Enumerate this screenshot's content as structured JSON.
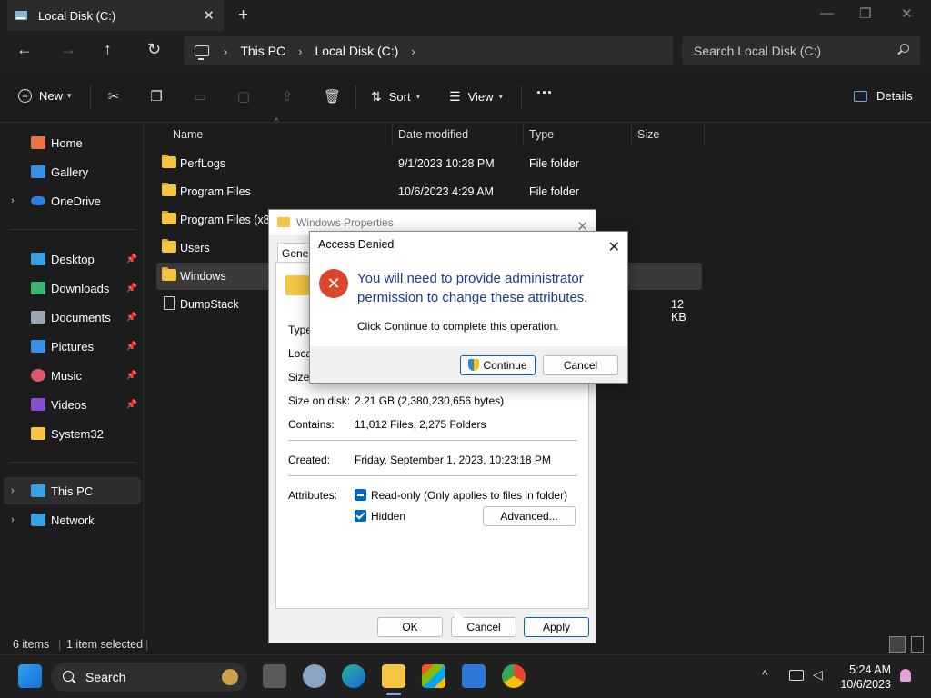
{
  "window": {
    "tab_title": "Local Disk (C:)",
    "new_tab": "+",
    "minimize": "—",
    "maximize": "❐",
    "close": "✕"
  },
  "address": {
    "crumbs": [
      "This PC",
      "Local Disk (C:)"
    ],
    "search_placeholder": "Search Local Disk (C:)"
  },
  "toolbar": {
    "new_label": "New",
    "sort_label": "Sort",
    "view_label": "View",
    "more_label": "···",
    "details_label": "Details"
  },
  "sidebar": {
    "items": [
      {
        "label": "Home",
        "icon": "home-icon",
        "color": "#e8734a"
      },
      {
        "label": "Gallery",
        "icon": "gallery-icon",
        "color": "#3a8ee6"
      },
      {
        "label": "OneDrive",
        "icon": "onedrive-icon",
        "color": "#2d7fd8"
      },
      {
        "label": "Desktop",
        "icon": "desktop-icon",
        "color": "#3aa0e6"
      },
      {
        "label": "Downloads",
        "icon": "downloads-icon",
        "color": "#3cb371"
      },
      {
        "label": "Documents",
        "icon": "documents-icon",
        "color": "#9aa6b8"
      },
      {
        "label": "Pictures",
        "icon": "pictures-icon",
        "color": "#3a8ee6"
      },
      {
        "label": "Music",
        "icon": "music-icon",
        "color": "#e0566b"
      },
      {
        "label": "Videos",
        "icon": "videos-icon",
        "color": "#8a4fd1"
      },
      {
        "label": "System32",
        "icon": "folder-icon",
        "color": "#f4c542"
      },
      {
        "label": "This PC",
        "icon": "this-pc-icon",
        "color": "#3aa0e6"
      },
      {
        "label": "Network",
        "icon": "network-icon",
        "color": "#3aa0e6"
      }
    ]
  },
  "columns": {
    "name": "Name",
    "date": "Date modified",
    "type": "Type",
    "size": "Size"
  },
  "files": [
    {
      "name": "PerfLogs",
      "date": "9/1/2023 10:28 PM",
      "type": "File folder",
      "size": ""
    },
    {
      "name": "Program Files",
      "date": "10/6/2023 4:29 AM",
      "type": "File folder",
      "size": ""
    },
    {
      "name": "Program Files (x86",
      "date": "",
      "type": "",
      "size": ""
    },
    {
      "name": "Users",
      "date": "",
      "type": "",
      "size": ""
    },
    {
      "name": "Windows",
      "date": "",
      "type": "",
      "size": ""
    },
    {
      "name": "DumpStack",
      "date": "",
      "type": "",
      "size": "12 KB"
    }
  ],
  "status": {
    "items": "6 items",
    "selected": "1 item selected"
  },
  "properties": {
    "title": "Windows Properties",
    "tab": "Genera",
    "labels": {
      "type": "Type",
      "location": "Locat",
      "size": "Size:",
      "size_on_disk": "Size on disk:",
      "contains": "Contains:",
      "created": "Created:",
      "attributes": "Attributes:"
    },
    "values": {
      "size_on_disk": "2.21 GB (2,380,230,656 bytes)",
      "contains": "11,012 Files, 2,275 Folders",
      "created": "Friday, September 1, 2023, 10:23:18 PM"
    },
    "readonly_label": "Read-only (Only applies to files in folder)",
    "hidden_label": "Hidden",
    "advanced_label": "Advanced...",
    "ok_label": "OK",
    "cancel_label": "Cancel",
    "apply_label": "Apply"
  },
  "denied": {
    "title": "Access Denied",
    "message": "You will need to provide administrator permission to change these attributes.",
    "sub": "Click Continue to complete this operation.",
    "continue_label": "Continue",
    "cancel_label": "Cancel"
  },
  "taskbar": {
    "search_label": "Search",
    "time": "5:24 AM",
    "date": "10/6/2023"
  }
}
